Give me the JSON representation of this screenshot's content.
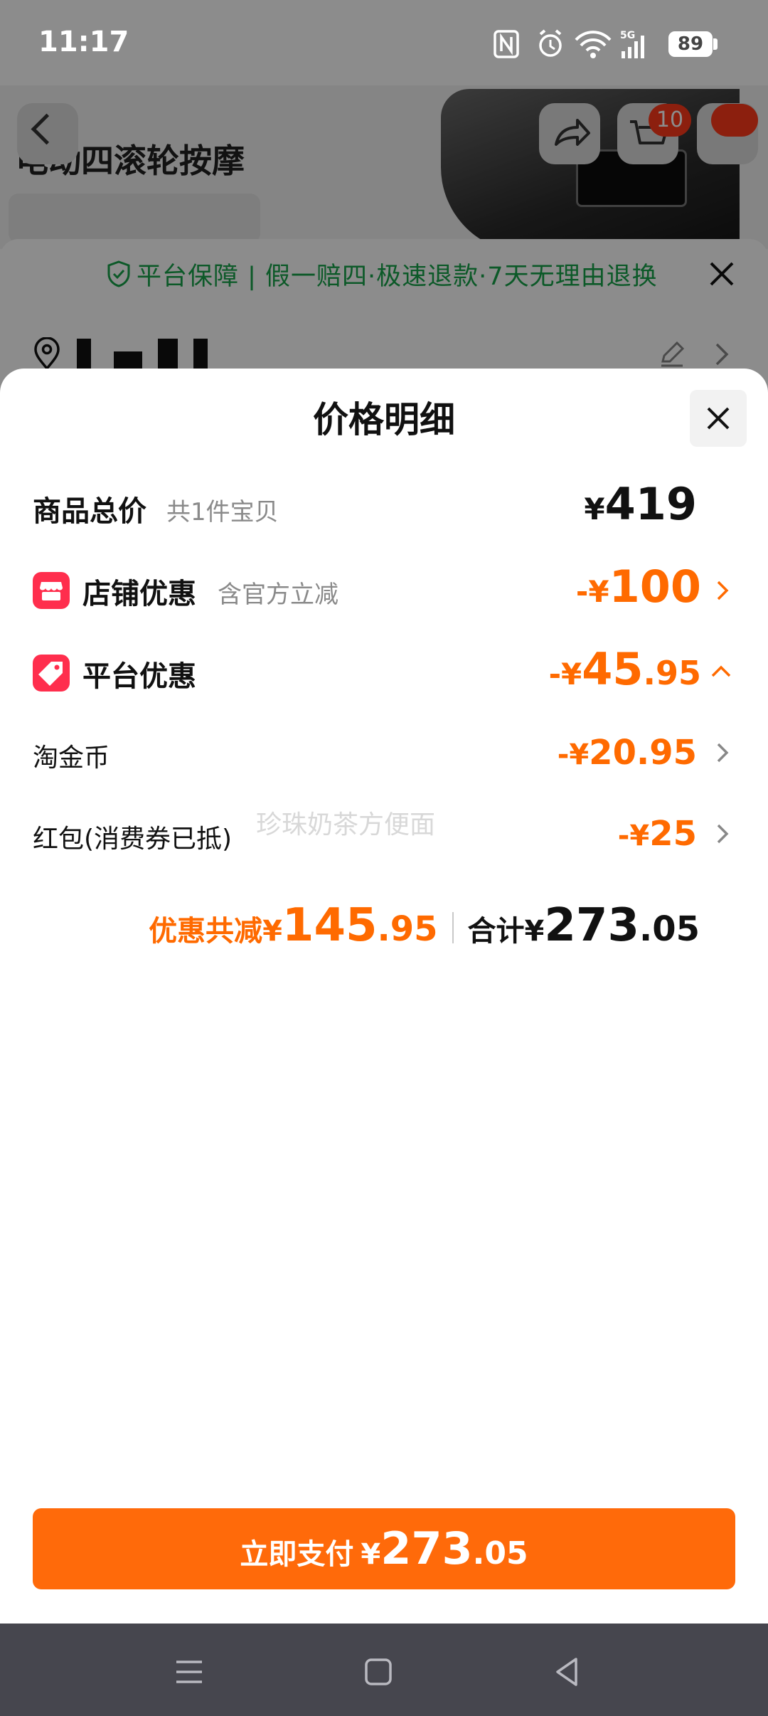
{
  "status_bar": {
    "time": "11:17",
    "battery": "89"
  },
  "background": {
    "product_title": "电动四滚轮按摩",
    "cart_count": "10",
    "guarantee_text": "平台保障 | 假一赔四·极速退款·7天无理由退换"
  },
  "sheet": {
    "title": "价格明细",
    "watermark": "珍珠奶茶方便面",
    "rows": {
      "goods_total": {
        "label": "商品总价",
        "sub": "共1件宝贝",
        "currency": "¥",
        "int": "419",
        "dec": ""
      },
      "shop_discount": {
        "label": "店铺优惠",
        "sub": "含官方立减",
        "currency": "-¥",
        "int": "100",
        "dec": ""
      },
      "platform_discount": {
        "label": "平台优惠",
        "currency": "-¥",
        "int": "45",
        "dec": ".95"
      },
      "taojinbi": {
        "label": "淘金币",
        "currency": "-¥",
        "int": "20.95",
        "dec": ""
      },
      "red_packet": {
        "label": "红包(消费券已抵)",
        "currency": "-¥",
        "int": "25",
        "dec": ""
      }
    },
    "summary": {
      "discount_label": "优惠共减",
      "discount_currency": "¥",
      "discount_int": "145",
      "discount_dec": ".95",
      "total_label": "合计",
      "total_currency": "¥",
      "total_int": "273",
      "total_dec": ".05"
    }
  },
  "pay_button": {
    "label": "立即支付",
    "currency": "¥",
    "int": "273",
    "dec": ".05"
  },
  "colors": {
    "accent": "#ff6a00",
    "pay_button": "#ff6a0a",
    "badge": "#ff2e4d",
    "guarantee_green": "#16a34a"
  },
  "icons": [
    "nfc-icon",
    "alarm-icon",
    "wifi-icon",
    "signal-5g-icon",
    "battery-icon",
    "shield-check-icon",
    "close-icon",
    "location-icon",
    "edit-icon",
    "chevron-right-icon",
    "shop-icon",
    "tag-icon",
    "chevron-up-icon",
    "menu-icon",
    "home-square-icon",
    "back-triangle-icon"
  ]
}
